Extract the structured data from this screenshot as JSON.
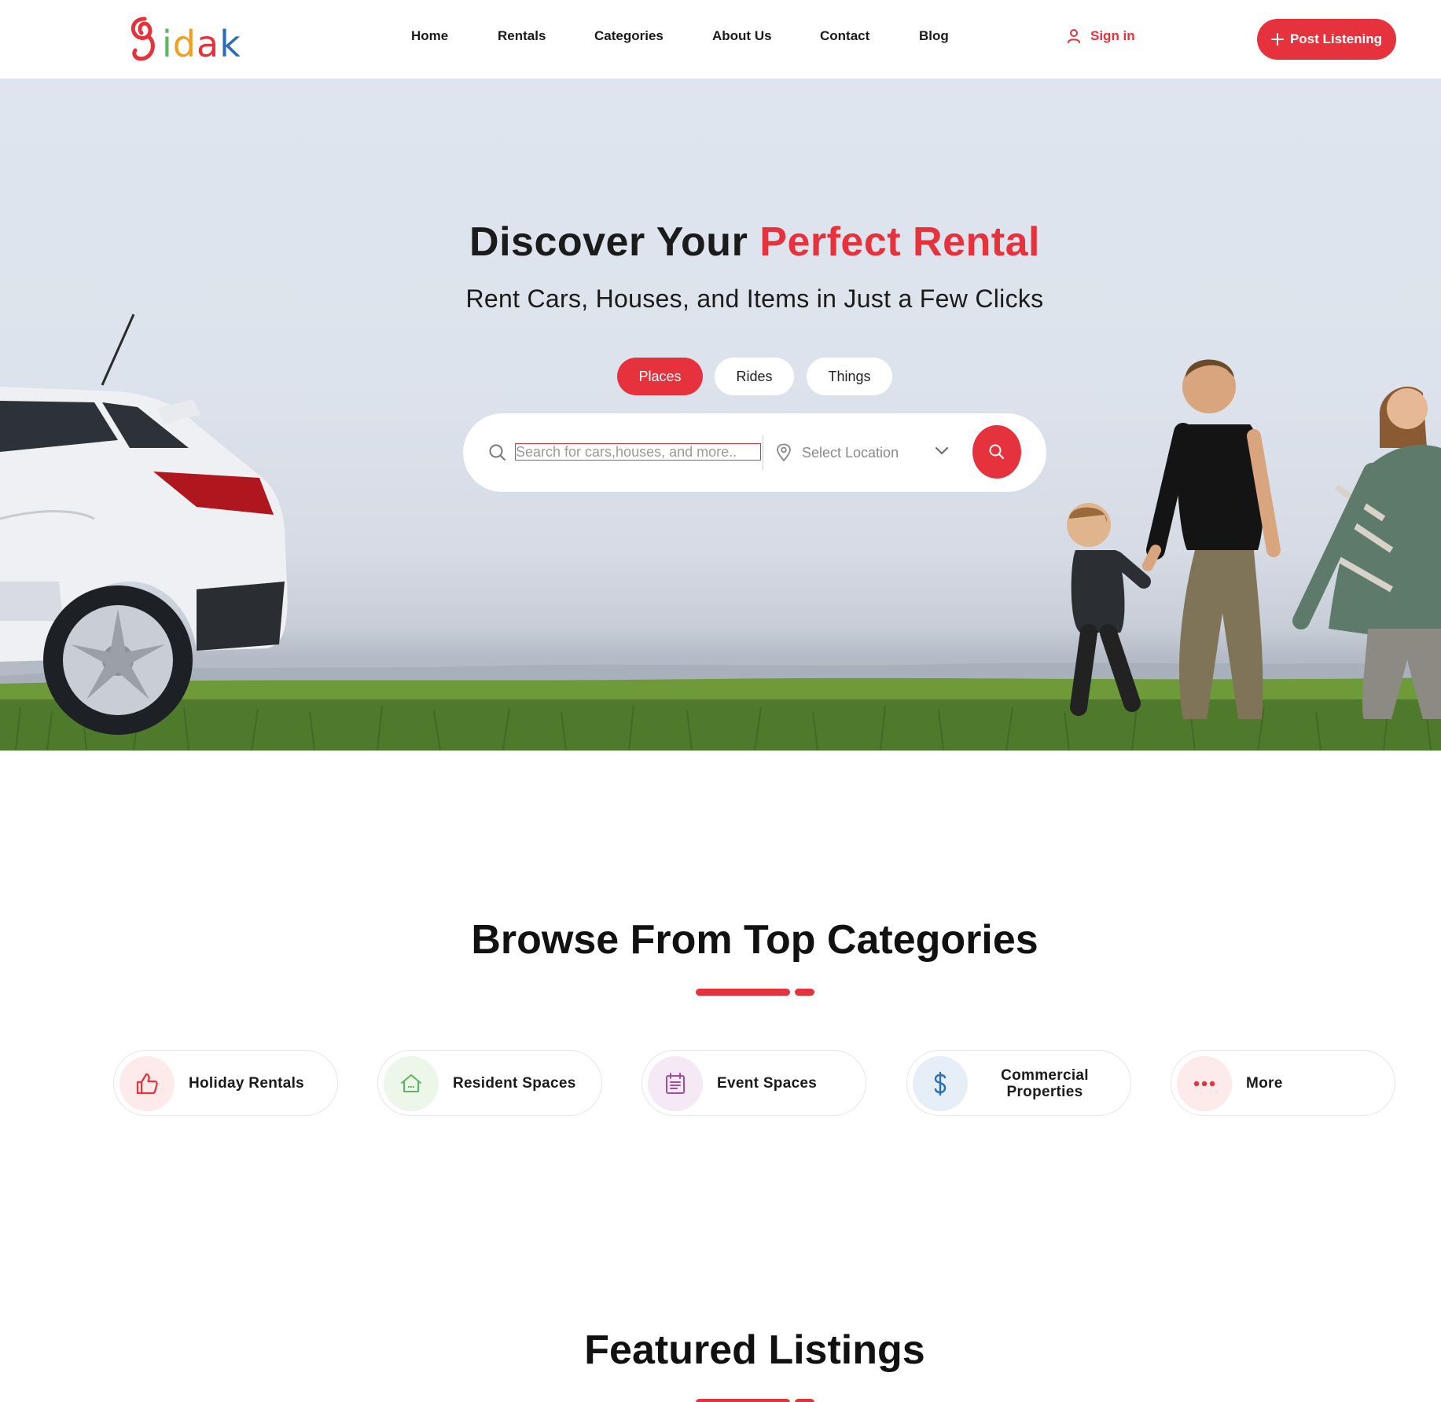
{
  "header": {
    "logo_text": "idak",
    "nav": [
      "Home",
      "Rentals",
      "Categories",
      "About Us",
      "Contact",
      "Blog"
    ],
    "signin_label": "Sign in",
    "post_button_label": "Post Listening"
  },
  "hero": {
    "title_main": "Discover Your",
    "title_accent": "Perfect Rental",
    "subtitle": "Rent Cars, Houses, and Items in Just a Few Clicks",
    "tabs": [
      "Places",
      "Rides",
      "Things"
    ],
    "active_tab": "Places",
    "search_placeholder": "Search for cars,houses, and more..",
    "location_placeholder": "Select Location"
  },
  "categories": {
    "title": "Browse From Top Categories",
    "items": [
      {
        "label": "Holiday Rentals",
        "icon": "thumbs-up-icon",
        "color": "#e6323c",
        "bg": "#fdeaea"
      },
      {
        "label": "Resident Spaces",
        "icon": "house-icon",
        "color": "#5cb85c",
        "bg": "#ecf7ea"
      },
      {
        "label": "Event Spaces",
        "icon": "calendar-list-icon",
        "color": "#9c4f9c",
        "bg": "#f4e9f4"
      },
      {
        "label": "Commercial Properties",
        "icon": "dollar-icon",
        "color": "#2a6fb8",
        "bg": "#e6eef8"
      },
      {
        "label": "More",
        "icon": "more-dots-icon",
        "color": "#e6323c",
        "bg": "#fdeaea"
      }
    ]
  },
  "featured": {
    "title": "Featured Listings"
  },
  "colors": {
    "accent": "#e6323c",
    "text": "#111111"
  }
}
